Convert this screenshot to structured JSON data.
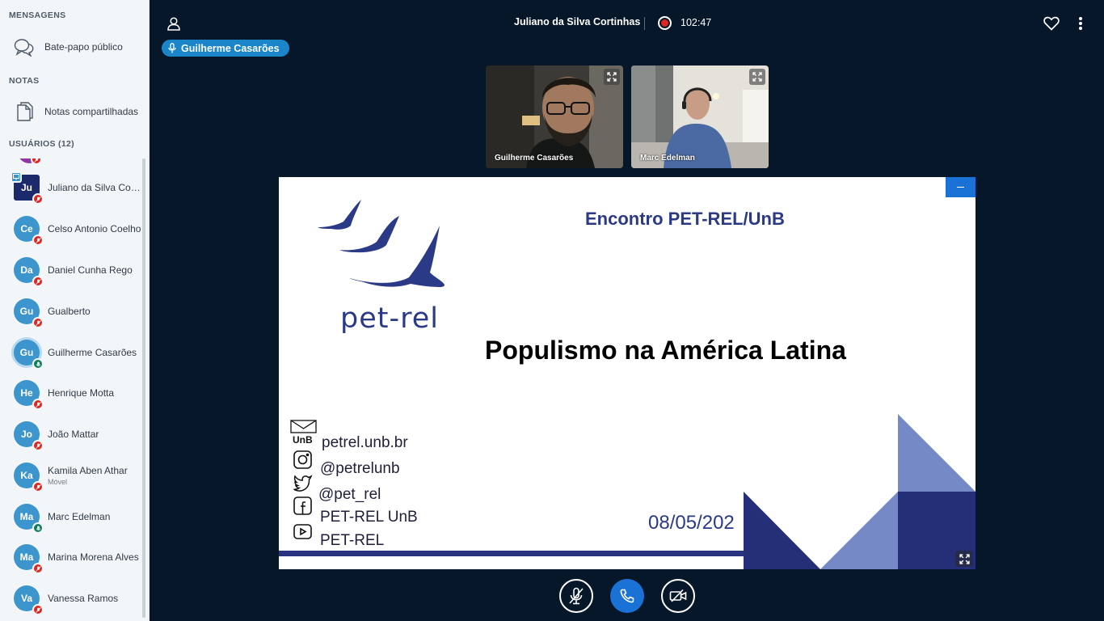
{
  "sidebar": {
    "messages_title": "MENSAGENS",
    "public_chat": "Bate-papo público",
    "notes_title": "NOTAS",
    "shared_notes": "Notas compartilhadas",
    "users_title": "USUÁRIOS (12)",
    "users": [
      {
        "initials": "Ju",
        "name": "Juliano da Silva Cortinhas",
        "mic": "muted",
        "presenter": true
      },
      {
        "initials": "Ce",
        "name": "Celso Antonio Coelho",
        "mic": "muted"
      },
      {
        "initials": "Da",
        "name": "Daniel Cunha Rego",
        "mic": "muted"
      },
      {
        "initials": "Gu",
        "name": "Gualberto",
        "mic": "muted"
      },
      {
        "initials": "Gu",
        "name": "Guilherme Casarões",
        "mic": "on",
        "talking": true
      },
      {
        "initials": "He",
        "name": "Henrique Motta",
        "mic": "muted"
      },
      {
        "initials": "Jo",
        "name": "João Mattar",
        "mic": "muted"
      },
      {
        "initials": "Ka",
        "name": "Kamila Aben Athar",
        "sub": "Móvel",
        "mic": "muted"
      },
      {
        "initials": "Ma",
        "name": "Marc Edelman",
        "mic": "on"
      },
      {
        "initials": "Ma",
        "name": "Marina Morena Alves",
        "mic": "muted"
      },
      {
        "initials": "Va",
        "name": "Vanessa Ramos",
        "mic": "muted"
      }
    ]
  },
  "topbar": {
    "meeting_title": "Juliano da Silva Cortinhas",
    "recording_time": "102:47",
    "current_talker": "Guilherme Casarões"
  },
  "webcams": [
    {
      "name": "Guilherme Casarões"
    },
    {
      "name": "Marc Edelman"
    }
  ],
  "slide": {
    "header": "Encontro PET-REL/UnB",
    "title": "Populismo na América Latina",
    "logo_text": "pet-rel",
    "unb_label": "UnB",
    "contacts": [
      "petrel.unb.br",
      "@petrelunb",
      "@pet_rel",
      "PET-REL UnB",
      "PET-REL"
    ],
    "date": "08/05/202",
    "colors": {
      "navy": "#2b3a86",
      "light_blue": "#7589c7",
      "dark_navy": "#252f78"
    }
  }
}
